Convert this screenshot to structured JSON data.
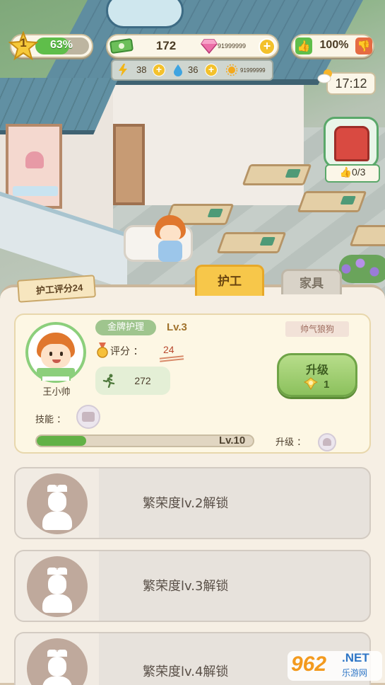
{
  "hud": {
    "level": "1",
    "exp_percent": "63%",
    "exp_fraction": 0.63,
    "money": "172",
    "gems": "91999999",
    "energy": "38",
    "water": "36",
    "sun": "91999999",
    "rating": "100%",
    "time": "17:12",
    "likes": "0/3"
  },
  "panel": {
    "score_tag": "护工评分24",
    "tabs": [
      "护工",
      "家具"
    ],
    "active_tab": 0
  },
  "caregiver": {
    "name": "王小帅",
    "title": "金牌护理",
    "level": "Lv.3",
    "nickname": "帅气狼狗",
    "score_label": "评分 ：",
    "score": "24",
    "speed": "272",
    "upgrade_label": "升级",
    "upgrade_cost": "1",
    "skill_label": "技能 ：",
    "max_level": "Lv.10",
    "level_progress": 0.23,
    "upgrade_text": "升级 ："
  },
  "locked_slots": [
    {
      "text": "繁荣度lv.2解锁"
    },
    {
      "text": "繁荣度lv.3解锁"
    },
    {
      "text": "繁荣度lv.4解锁"
    }
  ],
  "watermark": {
    "num": "962",
    "net": ".NET",
    "cn": "乐游网"
  },
  "colors": {
    "accent_green": "#5fbe4a",
    "tab_active": "#f7c74a",
    "panel_bg": "#f6efe4"
  },
  "icons": [
    "star-icon",
    "money-icon",
    "gem-icon",
    "plus-icon",
    "energy-icon",
    "water-icon",
    "sun-icon",
    "thumb-up-icon",
    "thumb-down-icon",
    "weather-icon",
    "medal-icon",
    "runner-icon",
    "coin-icon",
    "skill-icon",
    "nurse-icon"
  ]
}
